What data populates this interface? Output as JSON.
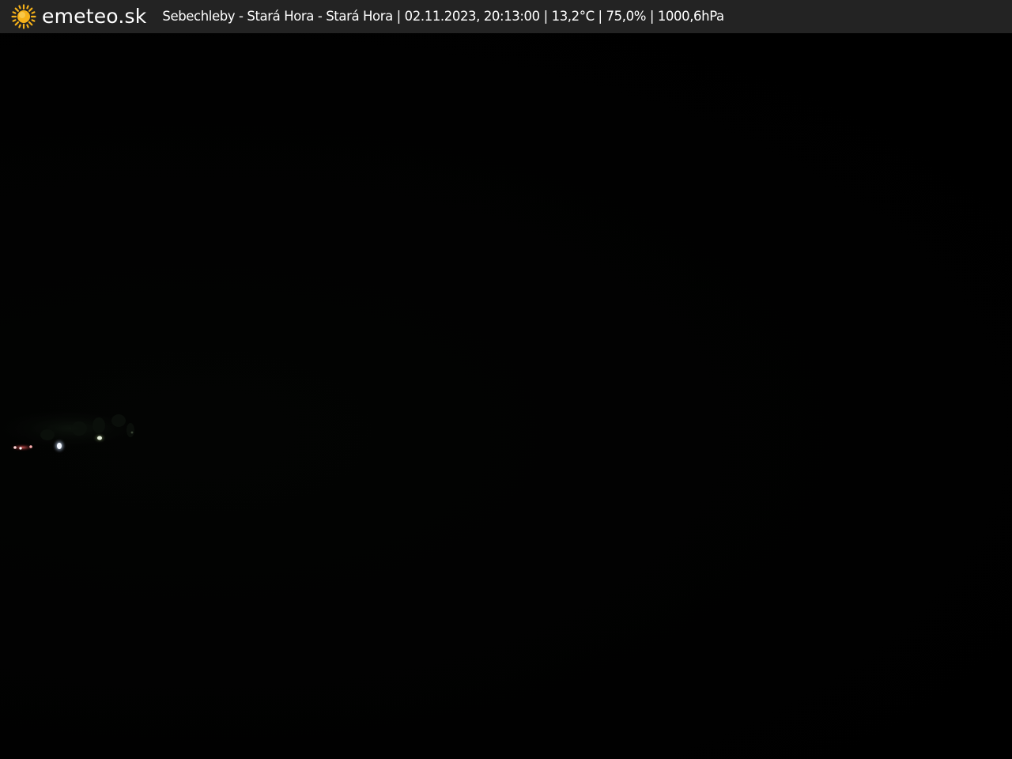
{
  "header": {
    "brand": "emeteo.sk",
    "logo_icon": "sun-icon",
    "location": "Sebechleby - Stará Hora - Stará Hora",
    "datetime": "02.11.2023, 20:13:00",
    "temperature": "13,2°C",
    "humidity": "75,0%",
    "pressure": "1000,6hPa",
    "caption": "Sebechleby - Stará Hora - Stará Hora | 02.11.2023, 20:13:00 | 13,2°C | 75,0% | 1000,6hPa"
  },
  "colors": {
    "bar_background": "#232323",
    "text": "#ffffff",
    "sun": "#f6b21a",
    "scene": "#010101"
  }
}
